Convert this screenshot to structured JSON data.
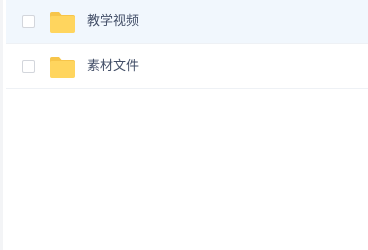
{
  "file_list": {
    "items": [
      {
        "name": "教学视频",
        "type": "folder",
        "icon": "folder-icon",
        "selected_highlight": true
      },
      {
        "name": "素材文件",
        "type": "folder",
        "icon": "folder-icon",
        "selected_highlight": false
      }
    ]
  },
  "colors": {
    "folder": "#ffd55e",
    "folder_tab": "#f7c54a",
    "row_highlight": "#f1f7fd",
    "text": "#424e67"
  }
}
